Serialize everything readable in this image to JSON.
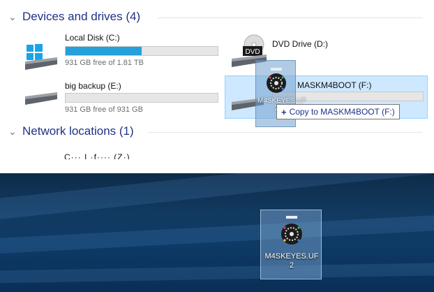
{
  "explorer": {
    "devices_header": "Devices and drives (4)",
    "network_header": "Network locations (1)",
    "drives": [
      {
        "label": "Local Disk (C:)",
        "free_text": "931 GB free of 1.81 TB",
        "used_fraction": 0.5
      },
      {
        "label": "DVD Drive (D:)",
        "dvd_badge": "DVD"
      },
      {
        "label": "big backup (E:)",
        "free_text": "931 GB free of 931 GB",
        "used_fraction": 0.0
      },
      {
        "label": "MASKM4BOOT (F:)",
        "used_fraction": 0.0
      }
    ],
    "network_item_partial": "C··· I ·f···· (Z·)",
    "drag": {
      "ghost_name_line1": "M4SKEYES.UF",
      "ghost_name_line2": "2",
      "tooltip_plus": "+",
      "tooltip_text": "Copy to MASKM4BOOT (F:)"
    }
  },
  "desktop": {
    "file_name_line1": "M4SKEYES.UF",
    "file_name_line2": "2"
  },
  "colors": {
    "header_blue": "#1e3287",
    "bar_fill": "#26a0da",
    "selection": "#cde8ff"
  }
}
